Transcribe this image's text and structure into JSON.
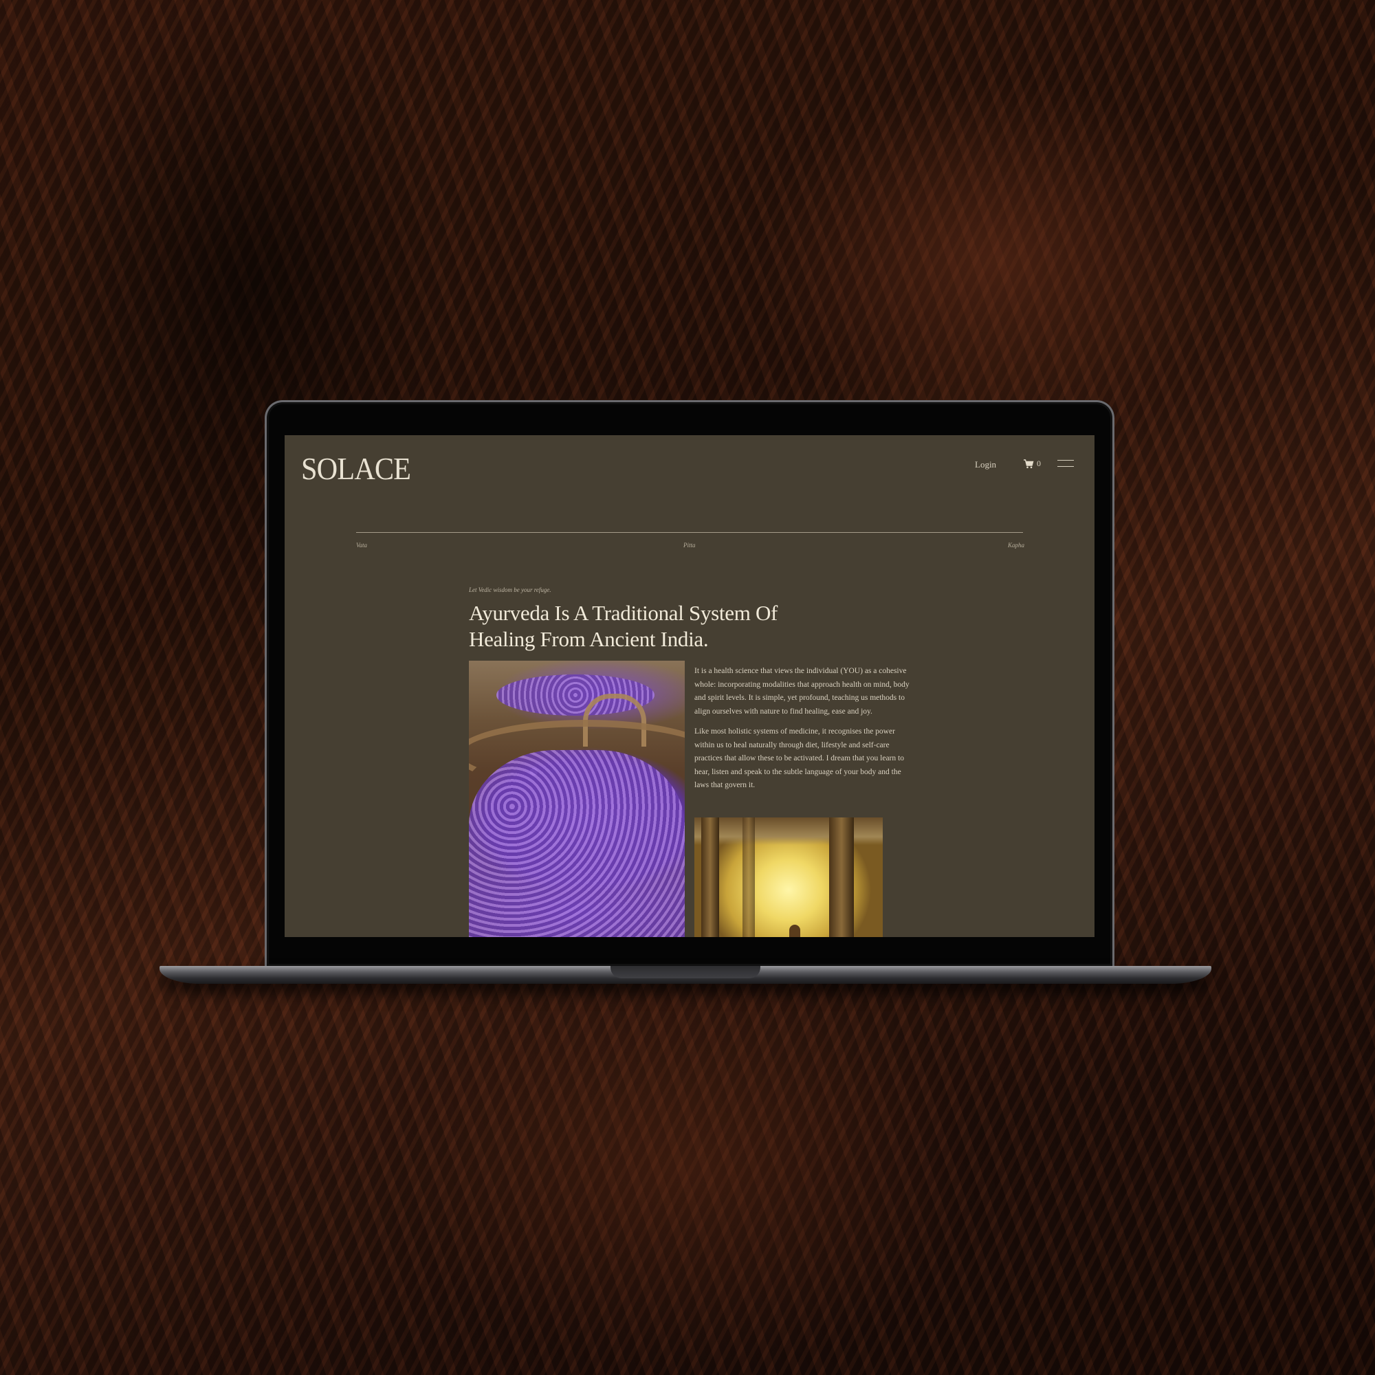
{
  "header": {
    "logo": "SOLACE",
    "login_label": "Login",
    "cart_icon": "cart-icon",
    "cart_count": "0",
    "menu_icon": "hamburger-menu-icon"
  },
  "doshas": [
    "Vata",
    "Pitta",
    "Kapha"
  ],
  "article": {
    "eyebrow": "Let Vedic wisdom be your refuge.",
    "headline": "Ayurveda Is A Traditional System Of Healing From Ancient India.",
    "paragraphs": [
      " It is a health science that views the individual (YOU) as a cohesive whole: incorporating modalities that approach health on mind, body and spirit levels. It is simple, yet profound, teaching us methods to align ourselves with nature to find healing, ease and joy.",
      "Like most holistic systems of medicine, it recognises the power within us to heal naturally through diet, lifestyle and self-care practices that allow these to be activated. I dream that you learn to hear, listen and speak to the subtle language of your body and the laws that govern it."
    ]
  },
  "colors": {
    "screen_bg": "#463f32",
    "text_light": "#f1ead9",
    "text_body": "#d9d1c0"
  }
}
